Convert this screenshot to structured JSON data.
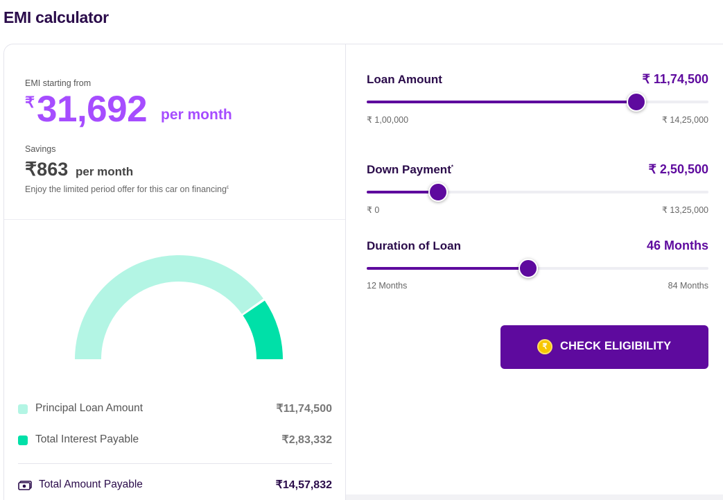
{
  "page": {
    "title": "EMI calculator"
  },
  "emi": {
    "label": "EMI starting from",
    "currency": "₹",
    "amount": "31,692",
    "per": "per month"
  },
  "savings": {
    "label": "Savings",
    "amount": "₹863",
    "per": "per month",
    "offer_text": "Enjoy the limited period offer for this car on financing",
    "offer_mark": "£"
  },
  "chart_data": {
    "type": "pie",
    "variant": "semi-donut",
    "categories": [
      "Principal Loan Amount",
      "Total Interest Payable"
    ],
    "values": [
      1174500,
      283332
    ],
    "colors": [
      "#b3f5e4",
      "#00e0a8"
    ]
  },
  "breakdown": [
    {
      "label": "Principal Loan Amount",
      "value": "₹11,74,500",
      "color": "#b3f5e4"
    },
    {
      "label": "Total Interest Payable",
      "value": "₹2,83,332",
      "color": "#00e0a8"
    }
  ],
  "total": {
    "label": "Total Amount Payable",
    "value": "₹14,57,832",
    "icon": "cash-icon"
  },
  "sliders": [
    {
      "label": "Loan Amount",
      "mark": "",
      "value": "₹ 11,74,500",
      "min": "₹ 1,00,000",
      "max": "₹ 14,25,000",
      "fraction": 0.79
    },
    {
      "label": "Down Payment",
      "mark": "*",
      "value": "₹ 2,50,500",
      "min": "₹ 0",
      "max": "₹ 13,25,000",
      "fraction": 0.208
    },
    {
      "label": "Duration of Loan",
      "mark": "",
      "value": "46 Months",
      "min": "12 Months",
      "max": "84 Months",
      "fraction": 0.472
    }
  ],
  "cta": {
    "label": "CHECK ELIGIBILITY",
    "icon": "rupee-coin-icon",
    "coin_symbol": "₹"
  },
  "colors": {
    "accent": "#5e0a9e",
    "emi": "#a64dff",
    "principal": "#b3f5e4",
    "interest": "#00e0a8"
  }
}
